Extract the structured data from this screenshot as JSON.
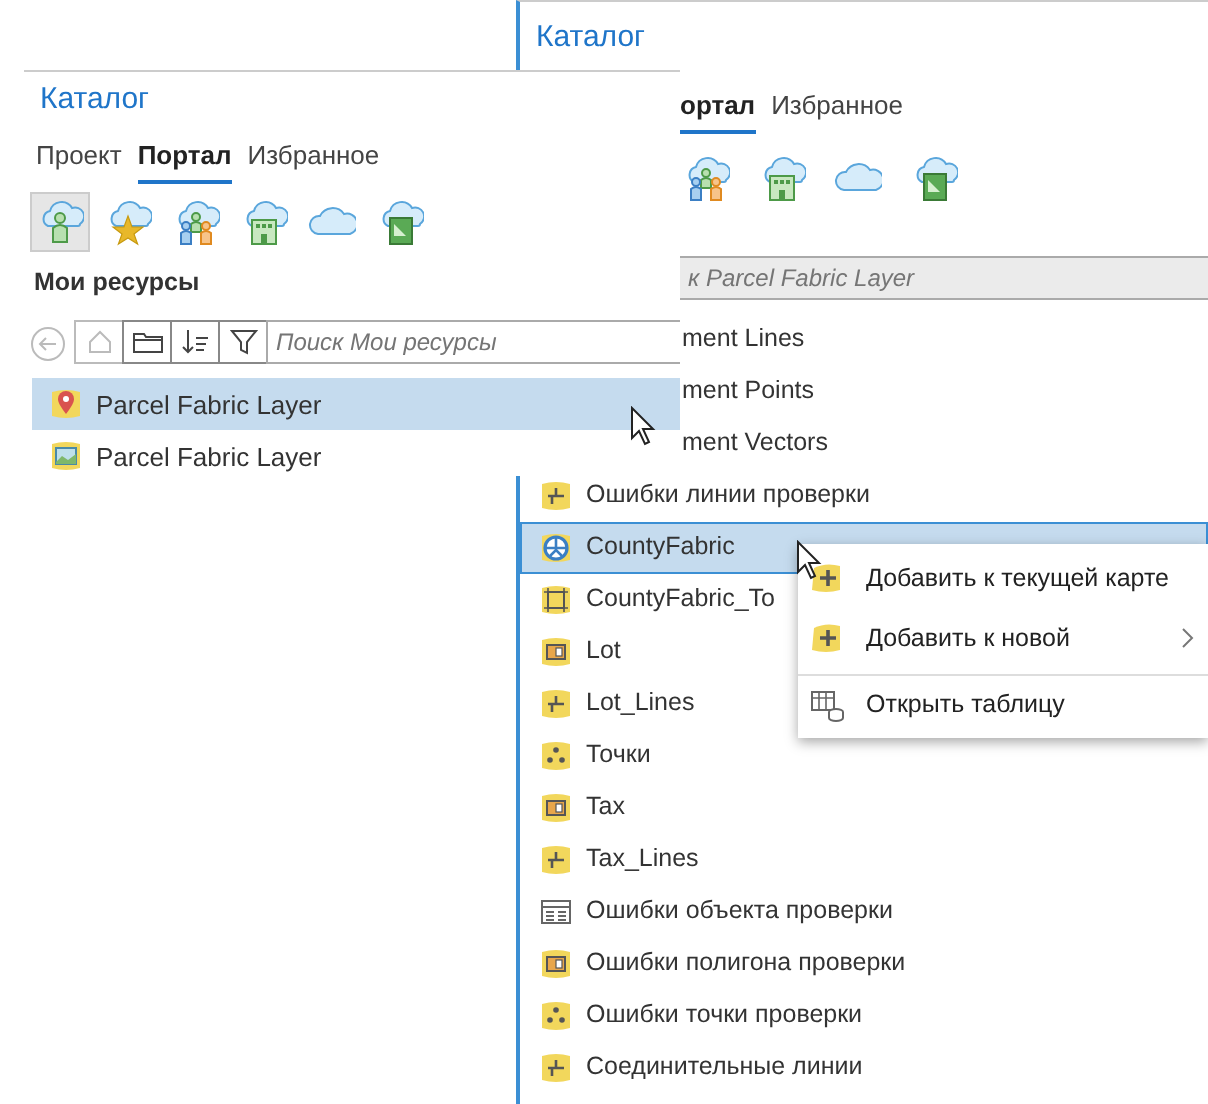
{
  "back_panel": {
    "title": "Каталог",
    "tabs": [
      {
        "label": "ортал",
        "selected": true
      },
      {
        "label": "Избранное",
        "selected": false
      }
    ],
    "portal_icons": [
      {
        "kind": "group"
      },
      {
        "kind": "building"
      },
      {
        "kind": "cloud"
      },
      {
        "kind": "document"
      }
    ],
    "search": {
      "placeholder": "к Parcel Fabric Layer"
    },
    "items": [
      {
        "label": "ment Lines",
        "selected": false
      },
      {
        "label": "ment Points",
        "selected": false
      },
      {
        "label": "ment Vectors",
        "selected": false
      },
      {
        "label": "Ошибки линии проверки",
        "kind": "line",
        "selected": false
      },
      {
        "label": "CountyFabric",
        "kind": "fabric",
        "selected": true
      },
      {
        "label": "CountyFabric_To",
        "kind": "topology",
        "selected": false
      },
      {
        "label": "Lot",
        "kind": "polygon",
        "selected": false
      },
      {
        "label": "Lot_Lines",
        "kind": "line",
        "selected": false
      },
      {
        "label": "Точки",
        "kind": "point",
        "selected": false
      },
      {
        "label": "Tax",
        "kind": "polygon",
        "selected": false
      },
      {
        "label": "Tax_Lines",
        "kind": "line",
        "selected": false
      },
      {
        "label": "Ошибки объекта проверки",
        "kind": "table",
        "selected": false
      },
      {
        "label": "Ошибки полигона проверки",
        "kind": "polygon",
        "selected": false
      },
      {
        "label": "Ошибки точки проверки",
        "kind": "point",
        "selected": false
      },
      {
        "label": "Соединительные линии",
        "kind": "line",
        "selected": false
      }
    ]
  },
  "front_panel": {
    "title": "Каталог",
    "tabs": [
      {
        "label": "Проект",
        "selected": false
      },
      {
        "label": "Портал",
        "selected": true
      },
      {
        "label": "Избранное",
        "selected": false
      }
    ],
    "portal_icons": [
      {
        "kind": "user",
        "selected": true
      },
      {
        "kind": "star",
        "selected": false
      },
      {
        "kind": "group",
        "selected": false
      },
      {
        "kind": "building",
        "selected": false
      },
      {
        "kind": "cloud",
        "selected": false
      },
      {
        "kind": "document",
        "selected": false
      }
    ],
    "section": "Мои ресурсы",
    "search": {
      "placeholder": "Поиск Мои ресурсы"
    },
    "items": [
      {
        "label": "Parcel Fabric Layer",
        "kind": "marker",
        "selected": true
      },
      {
        "label": "Parcel Fabric Layer",
        "kind": "image",
        "selected": false
      }
    ]
  },
  "context_menu": [
    {
      "label": "Добавить к текущей карте",
      "kind": "add",
      "submenu": false,
      "separator_before": false
    },
    {
      "label": "Добавить к новой",
      "kind": "add",
      "submenu": true,
      "separator_before": false
    },
    {
      "label": "Открыть таблицу",
      "kind": "table",
      "submenu": false,
      "separator_before": true
    }
  ]
}
